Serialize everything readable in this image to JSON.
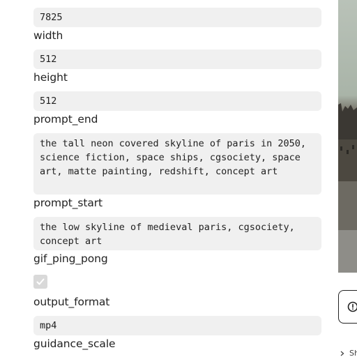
{
  "fields": {
    "seed": {
      "value": "7825"
    },
    "width": {
      "label": "width",
      "value": "512"
    },
    "height": {
      "label": "height",
      "value": "512"
    },
    "prompt_end": {
      "label": "prompt_end",
      "value": "the tall neon covered skyline of paris in 2050, science fiction, space ships, cgsociety, space art, matte painting, redshift, concept art"
    },
    "prompt_start": {
      "label": "prompt_start",
      "value": "the low skyline of medieval paris, cgsociety, concept art"
    },
    "gif_ping_pong": {
      "label": "gif_ping_pong",
      "checked": true
    },
    "output_format": {
      "label": "output_format",
      "value": "mp4"
    },
    "guidance_scale": {
      "label": "guidance_scale"
    }
  },
  "side": {
    "footer_link": "Sh"
  },
  "icons": {
    "info": "info-circle-icon",
    "check": "checkmark-icon",
    "chevron": "chevron-right-icon"
  },
  "colors": {
    "field_bg": "#f0f0f0",
    "text": "#222222",
    "checkbox_bg": "#d9d9d9"
  }
}
